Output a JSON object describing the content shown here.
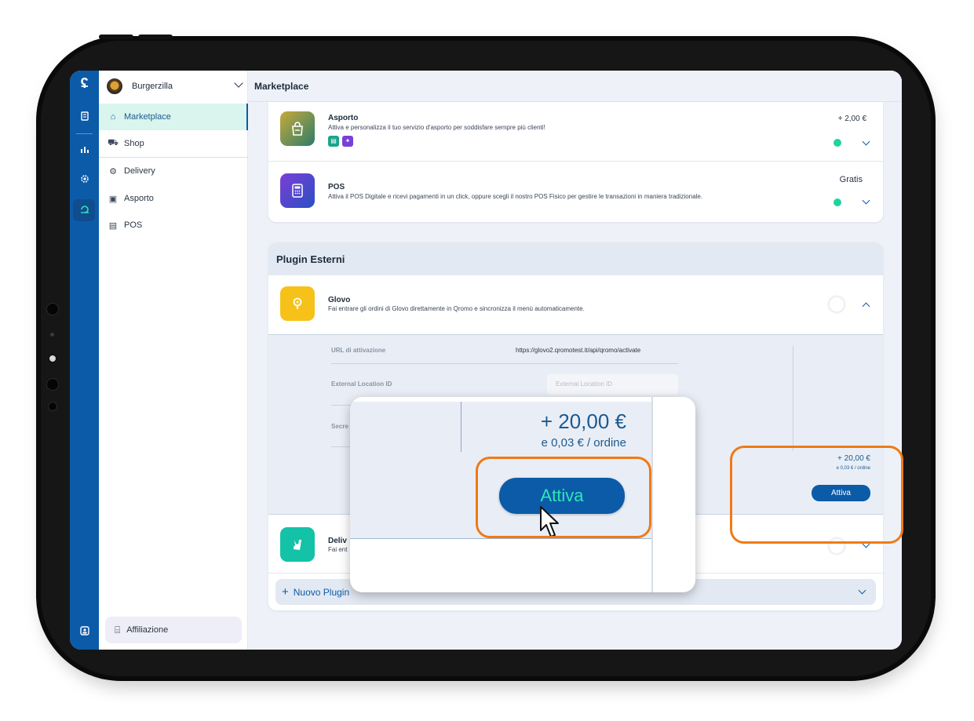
{
  "rail": {
    "logo": "ʢ",
    "icons": [
      "orders-icon",
      "analytics-icon",
      "settings-icon",
      "marketplace-icon",
      "support-icon"
    ]
  },
  "sidebar": {
    "store_name": "Burgerzilla",
    "items": [
      {
        "label": "Marketplace",
        "icon": "store-icon",
        "active": true
      },
      {
        "label": "Shop",
        "icon": "cart-icon",
        "active": false
      },
      {
        "label": "Delivery",
        "icon": "delivery-icon",
        "active": false
      },
      {
        "label": "Asporto",
        "icon": "bag-icon",
        "active": false
      },
      {
        "label": "POS",
        "icon": "pos-icon",
        "active": false
      }
    ],
    "affiliate_label": "Affiliazione"
  },
  "header": {
    "title": "Marketplace"
  },
  "apps": [
    {
      "title": "Asporto",
      "description": "Attiva e personalizza il tuo servizio d'asporto per soddisfare sempre più clienti!",
      "price": "+ 2,00 €",
      "active": true
    },
    {
      "title": "POS",
      "description": "Attiva il POS Digitale e ricevi pagamenti in un click, oppure scegli il nostro POS Fisico per gestire le transazioni in maniera tradizionale.",
      "price": "Gratis",
      "active": true
    }
  ],
  "plugins": {
    "section_title": "Plugin Esterni",
    "glovo": {
      "title": "Glovo",
      "description": "Fai entrare gli ordini di Glovo direttamente in Qromo e sincronizza il menù automaticamente.",
      "fields": {
        "url_label": "URL di attivazione",
        "url_value": "https://glovo2.qromotest.it/api/qromo/activate",
        "location_label": "External Location ID",
        "location_placeholder": "External Location ID",
        "secret_label": "Secre"
      },
      "price": "+ 20,00 €",
      "price_sub": "e 0,03 € / ordine",
      "button": "Attiva"
    },
    "deliveroo": {
      "title": "Deliv",
      "description": "Fai ent"
    },
    "new_plugin_label": "Nuovo Plugin"
  },
  "zoom": {
    "price": "+ 20,00 €",
    "price_sub": "e 0,03 € / ordine",
    "button": "Attiva"
  },
  "colors": {
    "brand_blue": "#0b5ba9",
    "accent_teal": "#20d3a0",
    "highlight_orange": "#f07a15"
  }
}
